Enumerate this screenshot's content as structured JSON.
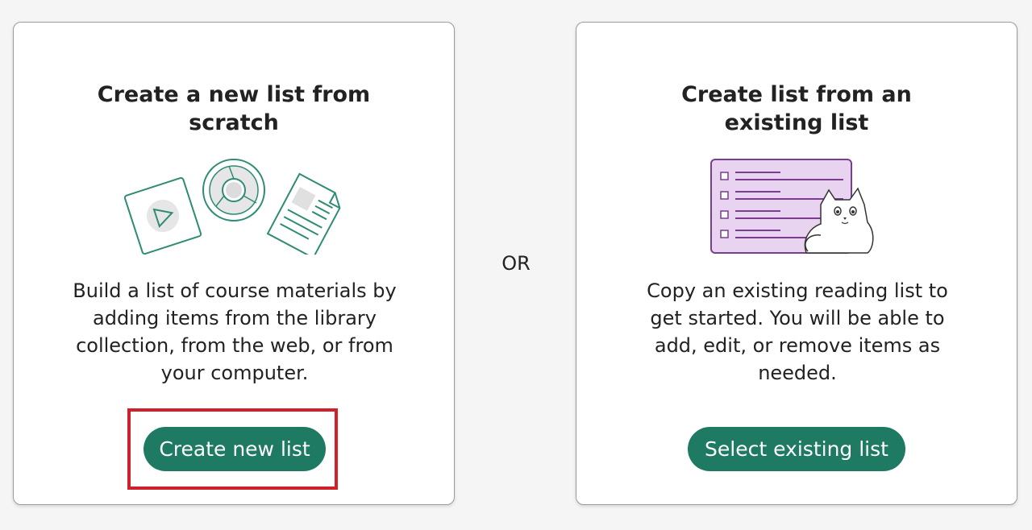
{
  "left_card": {
    "title_lines": [
      "Create a new list from",
      "scratch"
    ],
    "description_lines": [
      "Build a list of course materials by",
      "adding items from the library",
      "collection, from the web, or from",
      "your computer."
    ],
    "button_label": "Create new list"
  },
  "separator": {
    "label": "OR"
  },
  "right_card": {
    "title_lines": [
      "Create list from an",
      "existing list"
    ],
    "description_lines": [
      "Copy an existing reading list to",
      "get started. You will be able to",
      "add, edit, or remove items as",
      "needed."
    ],
    "button_label": "Select existing list"
  },
  "icons": {
    "left_illustration": [
      "play-icon",
      "chrome-icon",
      "document-icon"
    ],
    "right_illustration": [
      "checklist-icon",
      "cat-icon"
    ]
  },
  "colors": {
    "primary_button": "#1f7a64",
    "highlight_border": "#d0202a",
    "illustration_green": "#2e8b74",
    "list_purple": "#e8d4f0"
  }
}
